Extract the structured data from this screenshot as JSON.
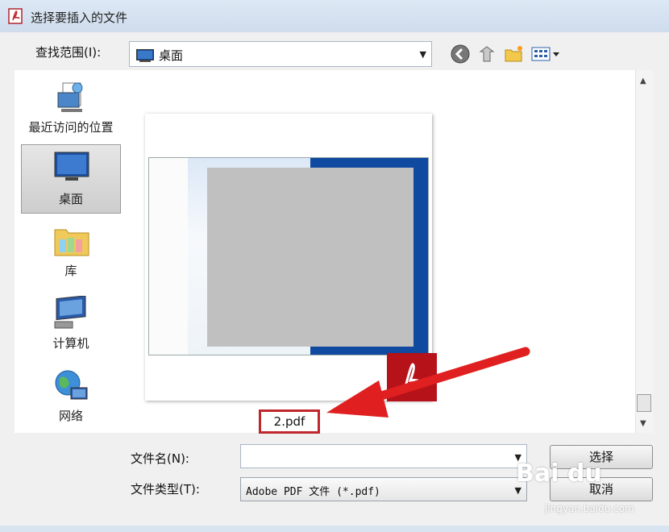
{
  "window": {
    "title": "选择要插入的文件"
  },
  "toolbar": {
    "lookin_label": "查找范围(I):",
    "lookin_value": "桌面"
  },
  "places": [
    {
      "label": "最近访问的位置"
    },
    {
      "label": "桌面",
      "selected": true
    },
    {
      "label": "库"
    },
    {
      "label": "计算机"
    },
    {
      "label": "网络"
    }
  ],
  "file_item": {
    "name": "2.pdf"
  },
  "filename": {
    "label": "文件名(N):",
    "value": ""
  },
  "filetype": {
    "label": "文件类型(T):",
    "value": "Adobe PDF 文件 (*.pdf)"
  },
  "buttons": {
    "select": "选择",
    "cancel": "取消"
  },
  "watermark": {
    "text": "Bai du",
    "url": "jingyan.baidu.com"
  },
  "colors": {
    "highlight": "#c0272b",
    "pdf_red": "#c8141a"
  }
}
